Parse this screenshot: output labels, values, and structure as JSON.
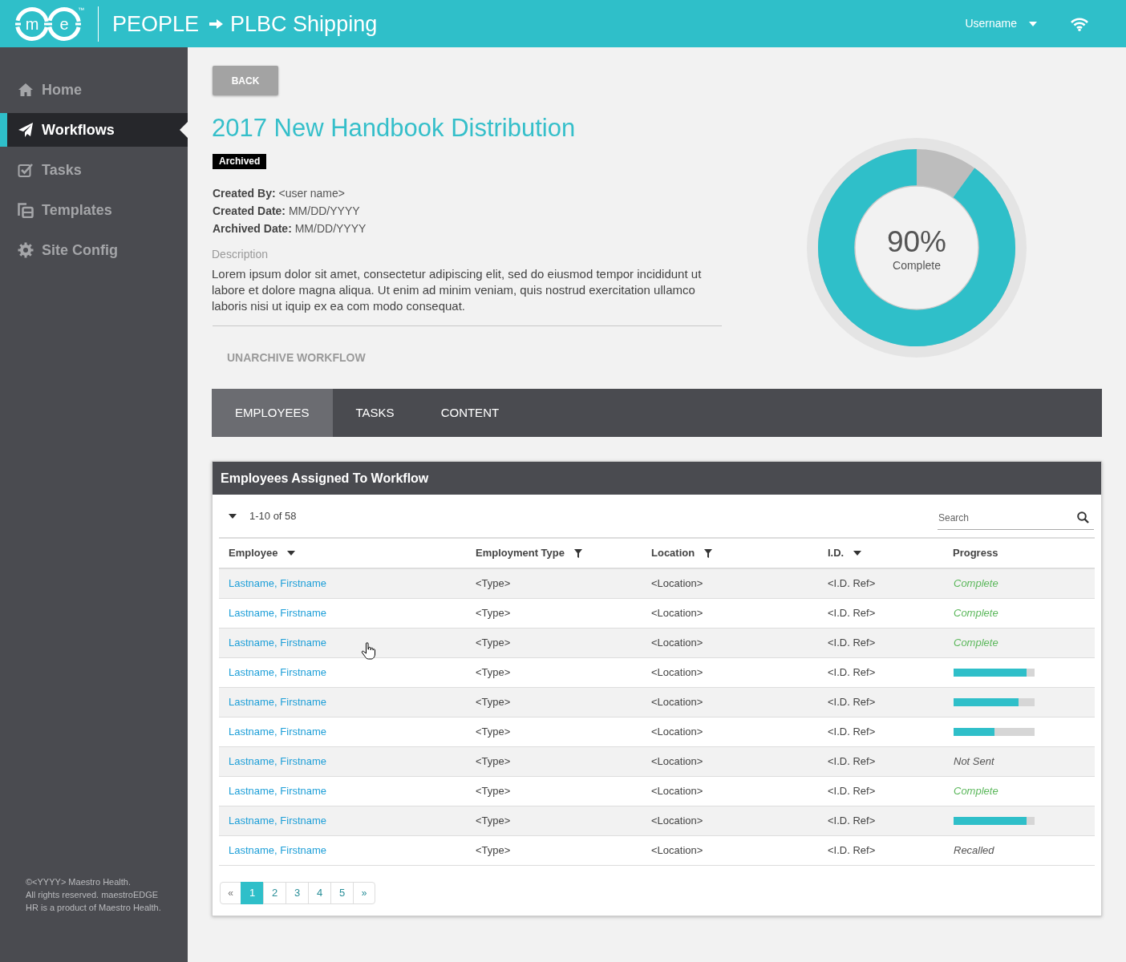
{
  "header": {
    "logo": {
      "letters": [
        "m",
        "e"
      ],
      "trademark": "™"
    },
    "breadcrumb": [
      "PEOPLE",
      "PLBC Shipping"
    ],
    "user_menu": {
      "label": "Username"
    }
  },
  "sidebar": {
    "items": [
      {
        "label": "Home",
        "selected": false
      },
      {
        "label": "Workflows",
        "selected": true
      },
      {
        "label": "Tasks",
        "selected": false
      },
      {
        "label": "Templates",
        "selected": false
      },
      {
        "label": "Site Config",
        "selected": false
      }
    ],
    "footer_lines": [
      "©<YYYY> Maestro Health.",
      "All rights reserved. maestroEDGE",
      "HR is a product of Maestro Health."
    ]
  },
  "back_button": {
    "label": "BACK"
  },
  "workflow": {
    "title": "2017 New Handbook Distribution",
    "status_badge": "Archived",
    "details": [
      {
        "label": "Created By:",
        "value": "<user name>"
      },
      {
        "label": "Created Date:",
        "value": "MM/DD/YYYY"
      },
      {
        "label": "Archived Date:",
        "value": "MM/DD/YYYY"
      }
    ],
    "description_label": "Description",
    "description": "Lorem ipsum dolor sit amet, consectetur adipiscing elit, sed do eiusmod tempor incididunt ut labore et dolore magna aliqua. Ut enim ad minim veniam, quis nostrud exercitation ullamco laboris nisi ut iquip ex ea com modo consequat.",
    "action": "UNARCHIVE WORKFLOW"
  },
  "completion": {
    "level": 0.9,
    "percent": "90%",
    "caption": "Complete"
  },
  "tabs": [
    {
      "label": "EMPLOYEES",
      "selected": true
    },
    {
      "label": "TASKS",
      "selected": false
    },
    {
      "label": "CONTENT",
      "selected": false
    }
  ],
  "employees_panel": {
    "title": "Employees Assigned To Workflow",
    "range": "1-10 of 58",
    "search": {
      "placeholder": "Search"
    },
    "columns": [
      {
        "label": "Employee",
        "kind": "sort"
      },
      {
        "label": "Employment Type",
        "kind": "filter"
      },
      {
        "label": "Location",
        "kind": "filter"
      },
      {
        "label": "I.D.",
        "kind": "sort"
      },
      {
        "label": "Progress",
        "kind": "plain"
      }
    ],
    "rows": [
      {
        "employee": "Lastname, Firstname",
        "employment_type": "<Type>",
        "location": "<Location>",
        "id": "<I.D. Ref>",
        "progress": {
          "kind": "status",
          "text": "Complete",
          "color": "#5cb85c"
        }
      },
      {
        "employee": "Lastname, Firstname",
        "employment_type": "<Type>",
        "location": "<Location>",
        "id": "<I.D. Ref>",
        "progress": {
          "kind": "status",
          "text": "Complete",
          "color": "#5cb85c"
        }
      },
      {
        "employee": "Lastname, Firstname",
        "employment_type": "<Type>",
        "location": "<Location>",
        "id": "<I.D. Ref>",
        "progress": {
          "kind": "status",
          "text": "Complete",
          "color": "#5cb85c"
        }
      },
      {
        "employee": "Lastname, Firstname",
        "employment_type": "<Type>",
        "location": "<Location>",
        "id": "<I.D. Ref>",
        "progress": {
          "kind": "bar",
          "level": 0.9
        }
      },
      {
        "employee": "Lastname, Firstname",
        "employment_type": "<Type>",
        "location": "<Location>",
        "id": "<I.D. Ref>",
        "progress": {
          "kind": "bar",
          "level": 0.8
        }
      },
      {
        "employee": "Lastname, Firstname",
        "employment_type": "<Type>",
        "location": "<Location>",
        "id": "<I.D. Ref>",
        "progress": {
          "kind": "bar",
          "level": 0.5
        }
      },
      {
        "employee": "Lastname, Firstname",
        "employment_type": "<Type>",
        "location": "<Location>",
        "id": "<I.D. Ref>",
        "progress": {
          "kind": "status",
          "text": "Not Sent",
          "color": "#555555"
        }
      },
      {
        "employee": "Lastname, Firstname",
        "employment_type": "<Type>",
        "location": "<Location>",
        "id": "<I.D. Ref>",
        "progress": {
          "kind": "status",
          "text": "Complete",
          "color": "#5cb85c"
        }
      },
      {
        "employee": "Lastname, Firstname",
        "employment_type": "<Type>",
        "location": "<Location>",
        "id": "<I.D. Ref>",
        "progress": {
          "kind": "bar",
          "level": 0.9
        }
      },
      {
        "employee": "Lastname, Firstname",
        "employment_type": "<Type>",
        "location": "<Location>",
        "id": "<I.D. Ref>",
        "progress": {
          "kind": "status",
          "text": "Recalled",
          "color": "#555555"
        }
      }
    ],
    "pagination": {
      "previous": "«",
      "pages": [
        {
          "label": "1",
          "selected": true
        },
        {
          "label": "2",
          "selected": false
        },
        {
          "label": "3",
          "selected": false
        },
        {
          "label": "4",
          "selected": false
        },
        {
          "label": "5",
          "selected": false
        }
      ],
      "next": "»"
    }
  }
}
